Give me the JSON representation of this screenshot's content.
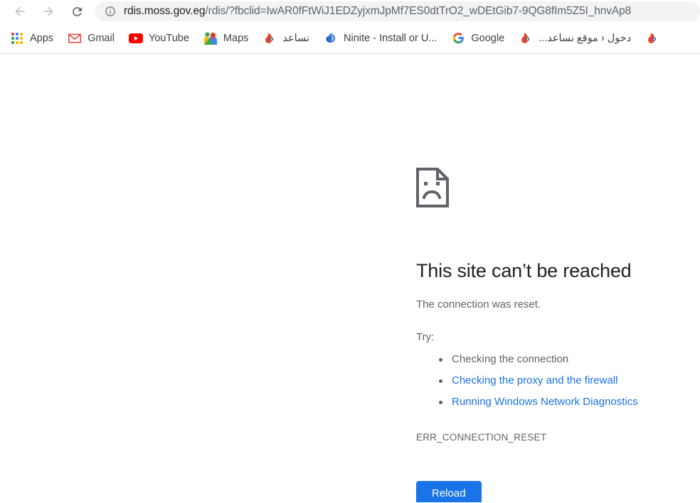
{
  "browser": {
    "nav": {
      "back_label": "Back",
      "forward_label": "Forward",
      "reload_label": "Reload page"
    },
    "omnibox": {
      "site_info_label": "View site information",
      "url_host": "rdis.moss.gov.eg",
      "url_rest": "/rdis/?fbclid=IwAR0fFtWiJ1EDZyjxmJpMf7ES0dtTrO2_wDEtGib7-9QG8fIm5Z5I_hnvAp8",
      "url_full": "rdis.moss.gov.eg/rdis/?fbclid=IwAR0fFtWiJ1EDZyjxmJpMf7ES0dtTrO2_wDEtGib7-9QG8fIm5Z5I_hnvAp8"
    }
  },
  "bookmarks": [
    {
      "label": "Apps",
      "icon": "apps-grid-icon"
    },
    {
      "label": "Gmail",
      "icon": "gmail-icon"
    },
    {
      "label": "YouTube",
      "icon": "youtube-icon"
    },
    {
      "label": "Maps",
      "icon": "google-maps-icon"
    },
    {
      "label": "نساعد",
      "icon": "nosaed-icon",
      "rtl": true
    },
    {
      "label": "Ninite - Install or U...",
      "icon": "ninite-icon"
    },
    {
      "label": "Google",
      "icon": "google-icon"
    },
    {
      "label": "دخول ‹ موقع نساعد...",
      "icon": "nosaed-icon",
      "rtl": true
    },
    {
      "label": "",
      "icon": "nosaed-icon",
      "icon_only": true
    }
  ],
  "error_page": {
    "icon": "sad-document-icon",
    "title": "This site can’t be reached",
    "summary": "The connection was reset.",
    "try_label": "Try:",
    "suggestions": [
      {
        "text": "Checking the connection",
        "is_link": false
      },
      {
        "text": "Checking the proxy and the firewall",
        "is_link": true
      },
      {
        "text": "Running Windows Network Diagnostics",
        "is_link": true
      }
    ],
    "error_code": "ERR_CONNECTION_RESET",
    "reload_button": "Reload"
  },
  "colors": {
    "link_blue": "#1a73e8",
    "button_blue": "#1a73e8",
    "text_primary": "#202124",
    "text_secondary": "#5f6368",
    "omnibox_bg": "#f1f3f4",
    "divider": "#dadce0"
  }
}
